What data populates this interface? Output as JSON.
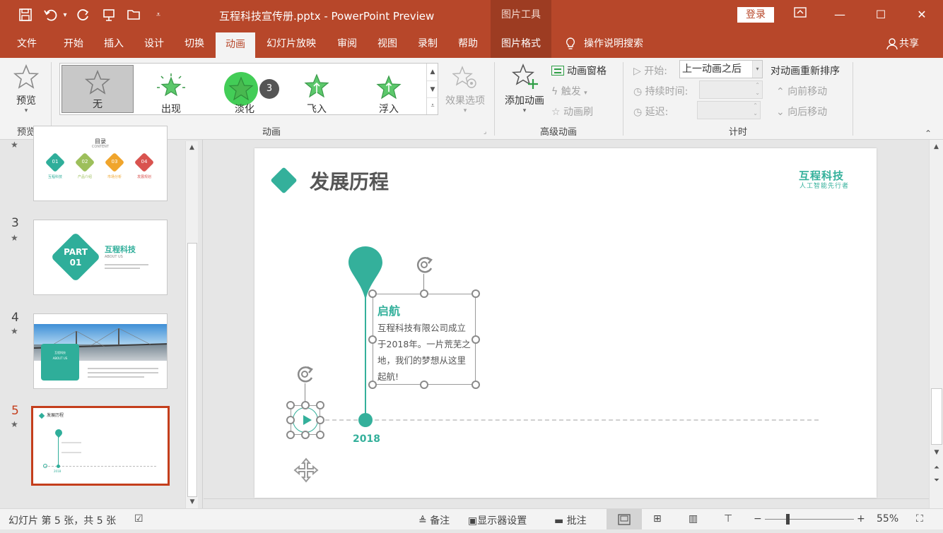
{
  "titlebar": {
    "doc_title": "互程科技宣传册.pptx  -  PowerPoint Preview",
    "context_tab_header": "图片工具",
    "login_label": "登录"
  },
  "tabs": [
    "文件",
    "开始",
    "插入",
    "设计",
    "切换",
    "动画",
    "幻灯片放映",
    "审阅",
    "视图",
    "录制",
    "帮助",
    "图片格式"
  ],
  "tell_me": "操作说明搜索",
  "share_label": "共享",
  "ribbon": {
    "preview": {
      "button": "预览",
      "group": "预览"
    },
    "animation_group": "动画",
    "gallery": [
      {
        "label": "无",
        "selected": true
      },
      {
        "label": "出现",
        "selected": false
      },
      {
        "label": "淡化",
        "selected": false
      },
      {
        "label": "飞入",
        "selected": false
      },
      {
        "label": "浮入",
        "selected": false
      }
    ],
    "click_badge": "3",
    "effect_options": "效果选项",
    "advanced": {
      "add_animation": "添加动画",
      "animation_pane": "动画窗格",
      "trigger": "触发",
      "painter": "动画刷",
      "group": "高级动画"
    },
    "timing": {
      "start_label": "开始:",
      "start_value": "上一动画之后",
      "duration_label": "持续时间:",
      "delay_label": "延迟:",
      "reorder_title": "对动画重新排序",
      "move_earlier": "向前移动",
      "move_later": "向后移动",
      "group": "计时"
    }
  },
  "thumbnails": {
    "slide2": {
      "title": "目录",
      "subtitle": "CONTENT",
      "items": [
        {
          "num": "01",
          "label": "互程科技",
          "color": "#2fae9a"
        },
        {
          "num": "02",
          "label": "产品介绍",
          "color": "#9dbf5b"
        },
        {
          "num": "03",
          "label": "市场分析",
          "color": "#f0a52c"
        },
        {
          "num": "04",
          "label": "发展规划",
          "color": "#d9534f"
        }
      ]
    },
    "slide3": {
      "num": "3",
      "part": "PART",
      "part_num": "01",
      "title": "互程科技",
      "subtitle": "ABOUT US"
    },
    "slide4": {
      "num": "4",
      "box_title": "互程科技",
      "box_sub": "ABOUT US"
    },
    "slide5": {
      "num": "5",
      "title": "发展历程",
      "year": "2018"
    }
  },
  "slide": {
    "title": "发展历程",
    "logo_name": "互程科技",
    "logo_tagline": "人工智能先行者",
    "milestone_title": "启航",
    "milestone_text": "互程科技有限公司成立于2018年。一片荒芜之地，我们的梦想从这里起航!",
    "year": "2018",
    "accent_color": "#34b09b"
  },
  "status": {
    "slide_info": "幻灯片 第 5 张，共 5 张",
    "notes": "备注",
    "display_settings": "显示器设置",
    "comments": "批注",
    "zoom": "55%"
  }
}
